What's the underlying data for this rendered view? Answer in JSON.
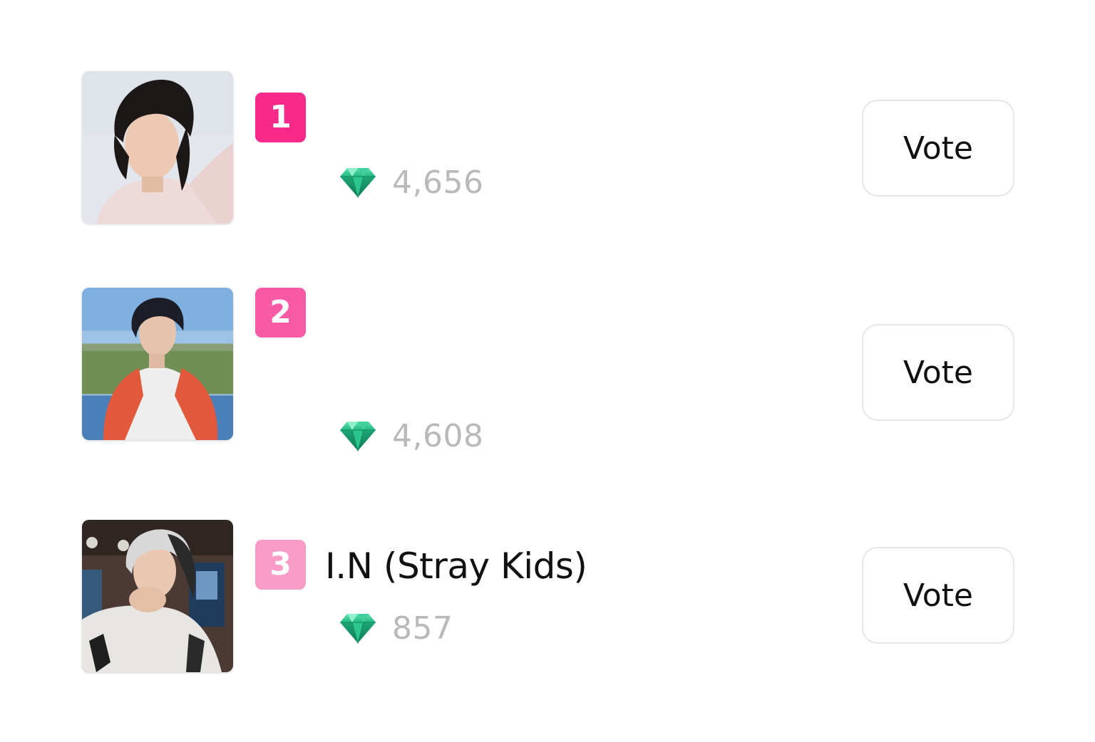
{
  "colors": {
    "badge_rank_1": "#f72a8c",
    "badge_rank_2": "#f85aa6",
    "badge_rank_3": "#fa9cc8",
    "vote_count": "#b9b9b9",
    "gem": "#1fb785"
  },
  "rankings": [
    {
      "rank": "1",
      "name": "",
      "votes": "4,656",
      "vote_label": "Vote",
      "gem_icon": "gem-icon",
      "photo": "artist-photo"
    },
    {
      "rank": "2",
      "name": "",
      "votes": "4,608",
      "vote_label": "Vote",
      "gem_icon": "gem-icon",
      "photo": "artist-photo"
    },
    {
      "rank": "3",
      "name": "I.N (Stray Kids)",
      "votes": "857",
      "vote_label": "Vote",
      "gem_icon": "gem-icon",
      "photo": "artist-photo"
    }
  ]
}
